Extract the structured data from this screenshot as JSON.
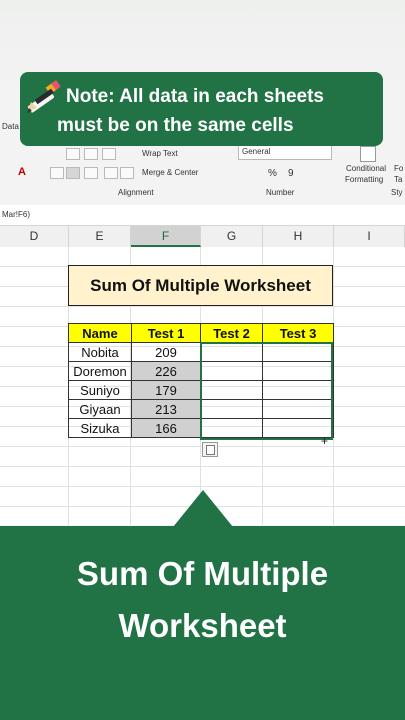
{
  "note": {
    "line1": "Note: All data in each sheets",
    "line2": "must be on the same cells",
    "icon": "pencil-icon"
  },
  "ribbon": {
    "tab_partial": "Data",
    "wrap_text": "Wrap Text",
    "merge_center": "Merge & Center",
    "number_format": "General",
    "percent": "%",
    "comma": "9",
    "alignment_group": "Alignment",
    "number_group": "Number",
    "conditional_formatting_line1": "Conditional",
    "conditional_formatting_line2": "Formatting",
    "format_as_table_partial_1": "Fo",
    "format_as_table_partial_2": "Ta",
    "styles_partial": "Sty"
  },
  "formula_bar": {
    "text": "Mar!F6)"
  },
  "columns": [
    "D",
    "E",
    "F",
    "G",
    "H",
    "I"
  ],
  "sheet": {
    "title": "Sum Of Multiple Worksheet",
    "headers": [
      "Name",
      "Test 1",
      "Test 2",
      "Test 3"
    ],
    "rows": [
      [
        "Nobita",
        "209",
        "",
        ""
      ],
      [
        "Doremon",
        "226",
        "",
        ""
      ],
      [
        "Suniyo",
        "179",
        "",
        ""
      ],
      [
        "Giyaan",
        "213",
        "",
        ""
      ],
      [
        "Sizuka",
        "166",
        "",
        ""
      ]
    ]
  },
  "bottom": {
    "line1": "Sum Of Multiple",
    "line2": "Worksheet"
  },
  "colors": {
    "accent": "#217346",
    "header_fill": "#ffff00",
    "title_fill": "#fff2cc"
  }
}
